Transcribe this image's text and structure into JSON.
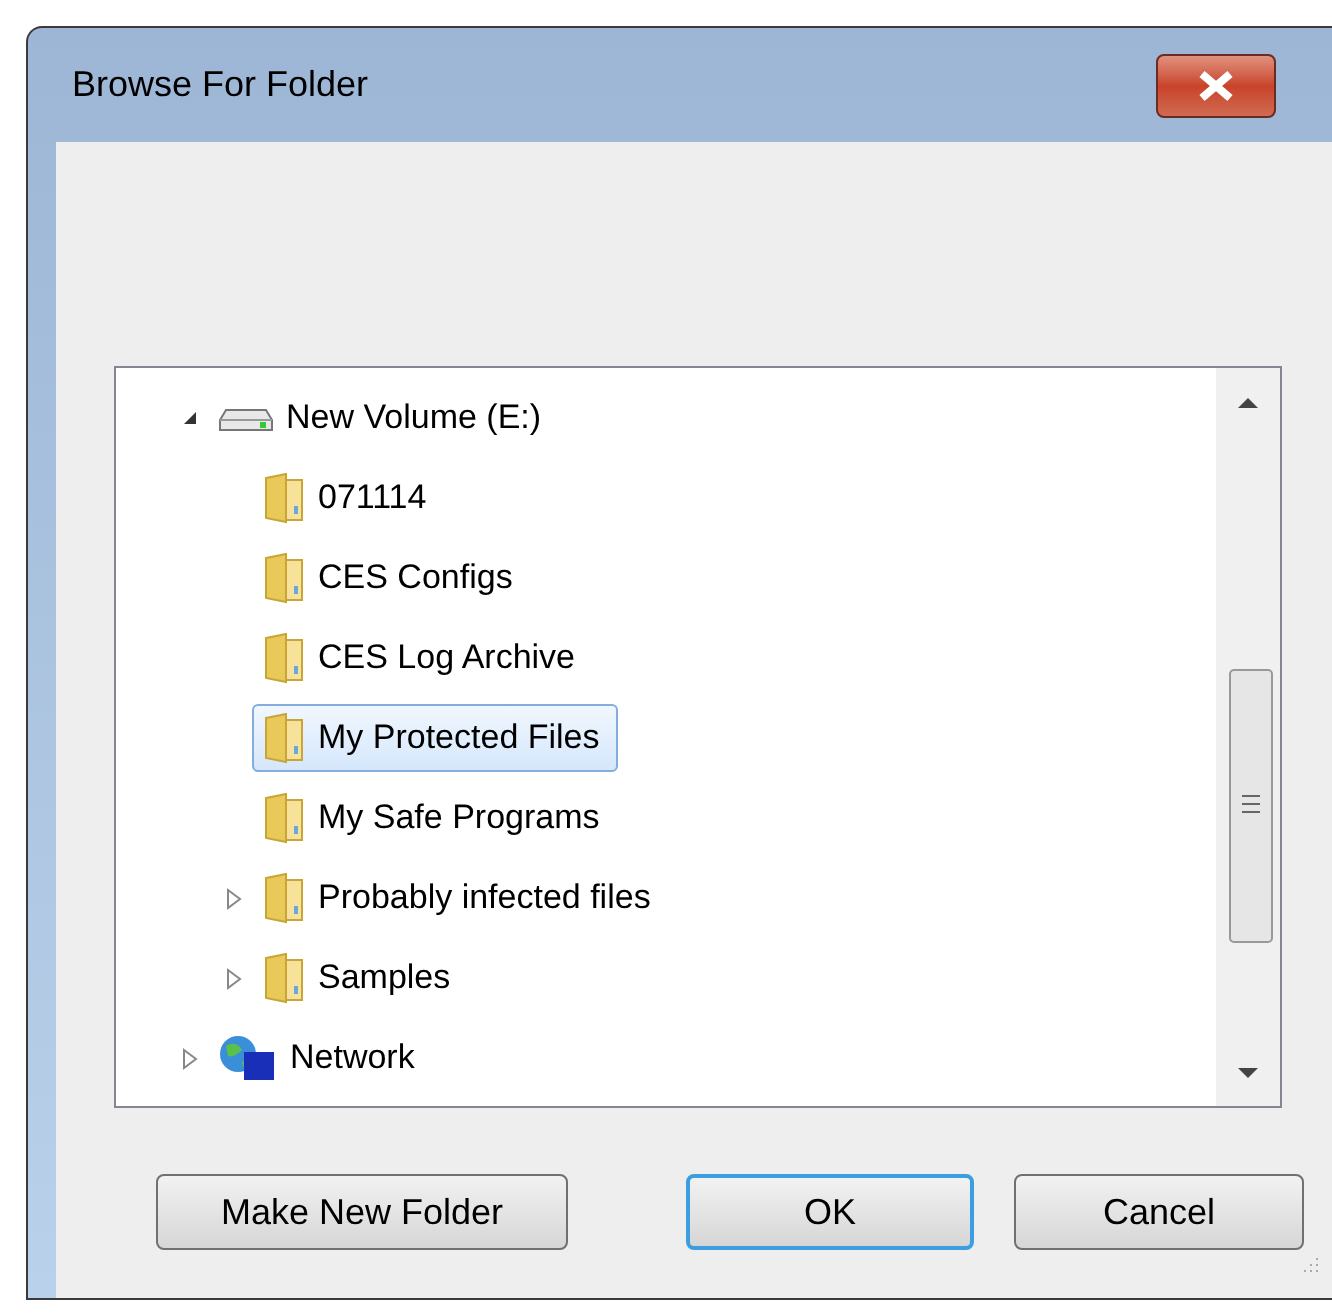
{
  "window": {
    "title": "Browse For Folder"
  },
  "tree": [
    {
      "label": "New Volume (E:)",
      "kind": "drive",
      "expanded": true,
      "selected": false,
      "children": [
        {
          "label": "071114",
          "kind": "folder",
          "selected": false
        },
        {
          "label": "CES Configs",
          "kind": "folder",
          "selected": false
        },
        {
          "label": "CES Log Archive",
          "kind": "folder",
          "selected": false
        },
        {
          "label": "My Protected Files",
          "kind": "folder",
          "selected": true
        },
        {
          "label": "My Safe Programs",
          "kind": "folder",
          "selected": false
        },
        {
          "label": "Probably infected files",
          "kind": "folder",
          "expanded": false,
          "selected": false
        },
        {
          "label": "Samples",
          "kind": "folder",
          "expanded": false,
          "selected": false
        }
      ]
    },
    {
      "label": "Network",
      "kind": "network",
      "expanded": false,
      "selected": false
    }
  ],
  "buttons": [
    {
      "label": "Make New Folder",
      "default": false
    },
    {
      "label": "OK",
      "default": true
    },
    {
      "label": "Cancel",
      "default": false
    }
  ]
}
